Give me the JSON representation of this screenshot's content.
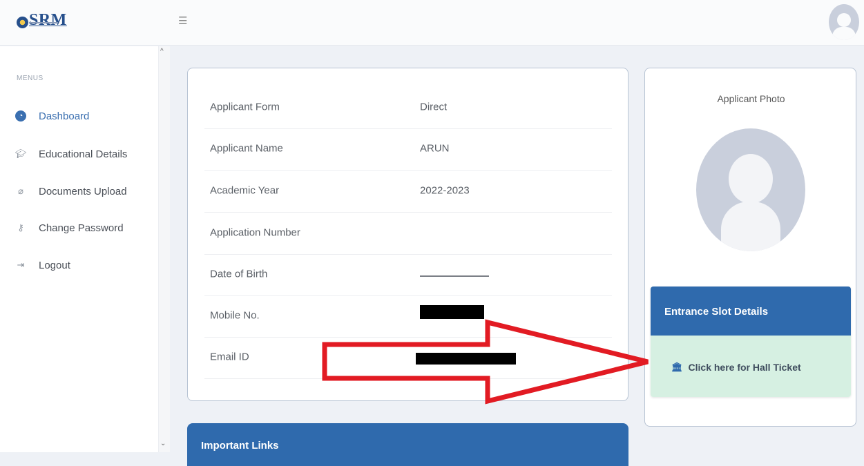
{
  "header": {
    "logo_text": "SRM",
    "menu_icon": "hamburger-icon",
    "avatar_icon": "user-avatar-icon"
  },
  "sidebar": {
    "section_label": "MENUS",
    "items": [
      {
        "label": "Dashboard",
        "icon": "dashboard-icon",
        "active": true
      },
      {
        "label": "Educational Details",
        "icon": "graduation-cap-icon",
        "active": false
      },
      {
        "label": "Documents Upload",
        "icon": "paperclip-icon",
        "active": false
      },
      {
        "label": "Change Password",
        "icon": "key-icon",
        "active": false
      },
      {
        "label": "Logout",
        "icon": "logout-icon",
        "active": false
      }
    ]
  },
  "applicant": {
    "rows": [
      {
        "label": "Applicant Form",
        "value": "Direct"
      },
      {
        "label": "Applicant Name",
        "value": "ARUN"
      },
      {
        "label": "Academic Year",
        "value": "2022-2023"
      },
      {
        "label": "Application Number",
        "value": ""
      },
      {
        "label": "Date of Birth",
        "value": ""
      },
      {
        "label": "Mobile No.",
        "value": ""
      },
      {
        "label": "Email ID",
        "value": ""
      }
    ]
  },
  "photo": {
    "label": "Applicant Photo"
  },
  "slot": {
    "title": "Entrance Slot Details",
    "hall_ticket_label": "Click here for Hall Ticket",
    "hall_ticket_icon": "bank-icon"
  },
  "links": {
    "title": "Important Links"
  },
  "colors": {
    "primary": "#2f6aad",
    "success_bg": "#d6f0e2",
    "annotation_red": "#e21b23"
  }
}
